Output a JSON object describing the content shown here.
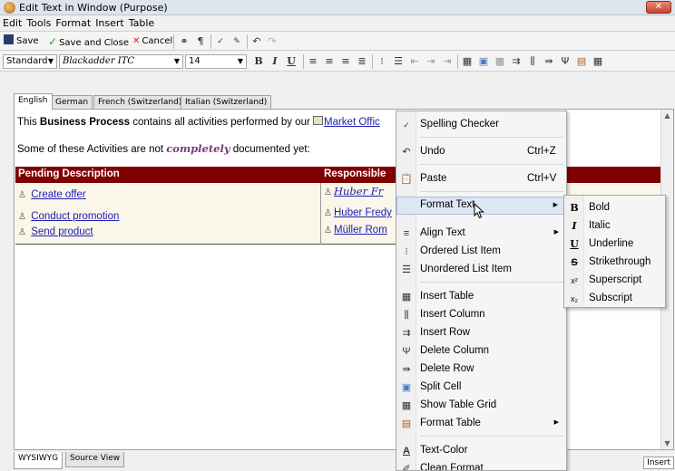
{
  "window": {
    "title": "Edit Text in Window (Purpose)",
    "close_label": "✕"
  },
  "menubar": [
    "Edit",
    "Tools",
    "Format",
    "Insert",
    "Table"
  ],
  "toolbar1": {
    "save": "Save",
    "save_close": "Save and Close",
    "cancel": "Cancel"
  },
  "toolbar2": {
    "style": "Standard",
    "font": "Blackadder ITC",
    "size": "14"
  },
  "language_tabs": [
    "English",
    "German",
    "French (Switzerland)",
    "Italian (Switzerland)"
  ],
  "document": {
    "p1_a": "This ",
    "p1_b": "Business Process",
    "p1_c": " contains all activities performed by our ",
    "p1_link": "Market Offic",
    "p2_a": "Some of these Activities are not ",
    "p2_b": "completely",
    "p2_c": " documented yet:",
    "table": {
      "headers": [
        "Pending Description",
        "Responsible"
      ],
      "rows": [
        {
          "desc": "Create offer",
          "resp": "Huber Fr"
        },
        {
          "desc": "Conduct promotion",
          "resp": "Huber Fredy"
        },
        {
          "desc": "Send product",
          "resp": "Müller Rom"
        }
      ]
    }
  },
  "context_menu": [
    {
      "icon": "spelling-icon",
      "label": "Spelling Checker",
      "shortcut": ""
    },
    {
      "icon": "undo-icon",
      "label": "Undo",
      "shortcut": "Ctrl+Z"
    },
    {
      "icon": "paste-icon",
      "label": "Paste",
      "shortcut": "Ctrl+V"
    },
    {
      "icon": "",
      "label": "Format Text",
      "shortcut": ""
    },
    {
      "icon": "align-icon",
      "label": "Align Text",
      "shortcut": ""
    },
    {
      "icon": "ordered-list-icon",
      "label": "Ordered List Item",
      "shortcut": ""
    },
    {
      "icon": "unordered-list-icon",
      "label": "Unordered List Item",
      "shortcut": ""
    },
    {
      "icon": "insert-table-icon",
      "label": "Insert Table",
      "shortcut": ""
    },
    {
      "icon": "insert-column-icon",
      "label": "Insert Column",
      "shortcut": ""
    },
    {
      "icon": "insert-row-icon",
      "label": "Insert Row",
      "shortcut": ""
    },
    {
      "icon": "delete-column-icon",
      "label": "Delete Column",
      "shortcut": ""
    },
    {
      "icon": "delete-row-icon",
      "label": "Delete Row",
      "shortcut": ""
    },
    {
      "icon": "split-cell-icon",
      "label": "Split Cell",
      "shortcut": ""
    },
    {
      "icon": "table-grid-icon",
      "label": "Show Table Grid",
      "shortcut": ""
    },
    {
      "icon": "format-table-icon",
      "label": "Format Table",
      "shortcut": ""
    },
    {
      "icon": "text-color-icon",
      "label": "Text-Color",
      "shortcut": ""
    },
    {
      "icon": "clean-format-icon",
      "label": "Clean Format",
      "shortcut": ""
    }
  ],
  "format_submenu": [
    "Bold",
    "Italic",
    "Underline",
    "Strikethrough",
    "Superscript",
    "Subscript"
  ],
  "bottom_tabs": [
    "WYSIWYG",
    "Source View"
  ],
  "status": {
    "mode": "Insert"
  }
}
